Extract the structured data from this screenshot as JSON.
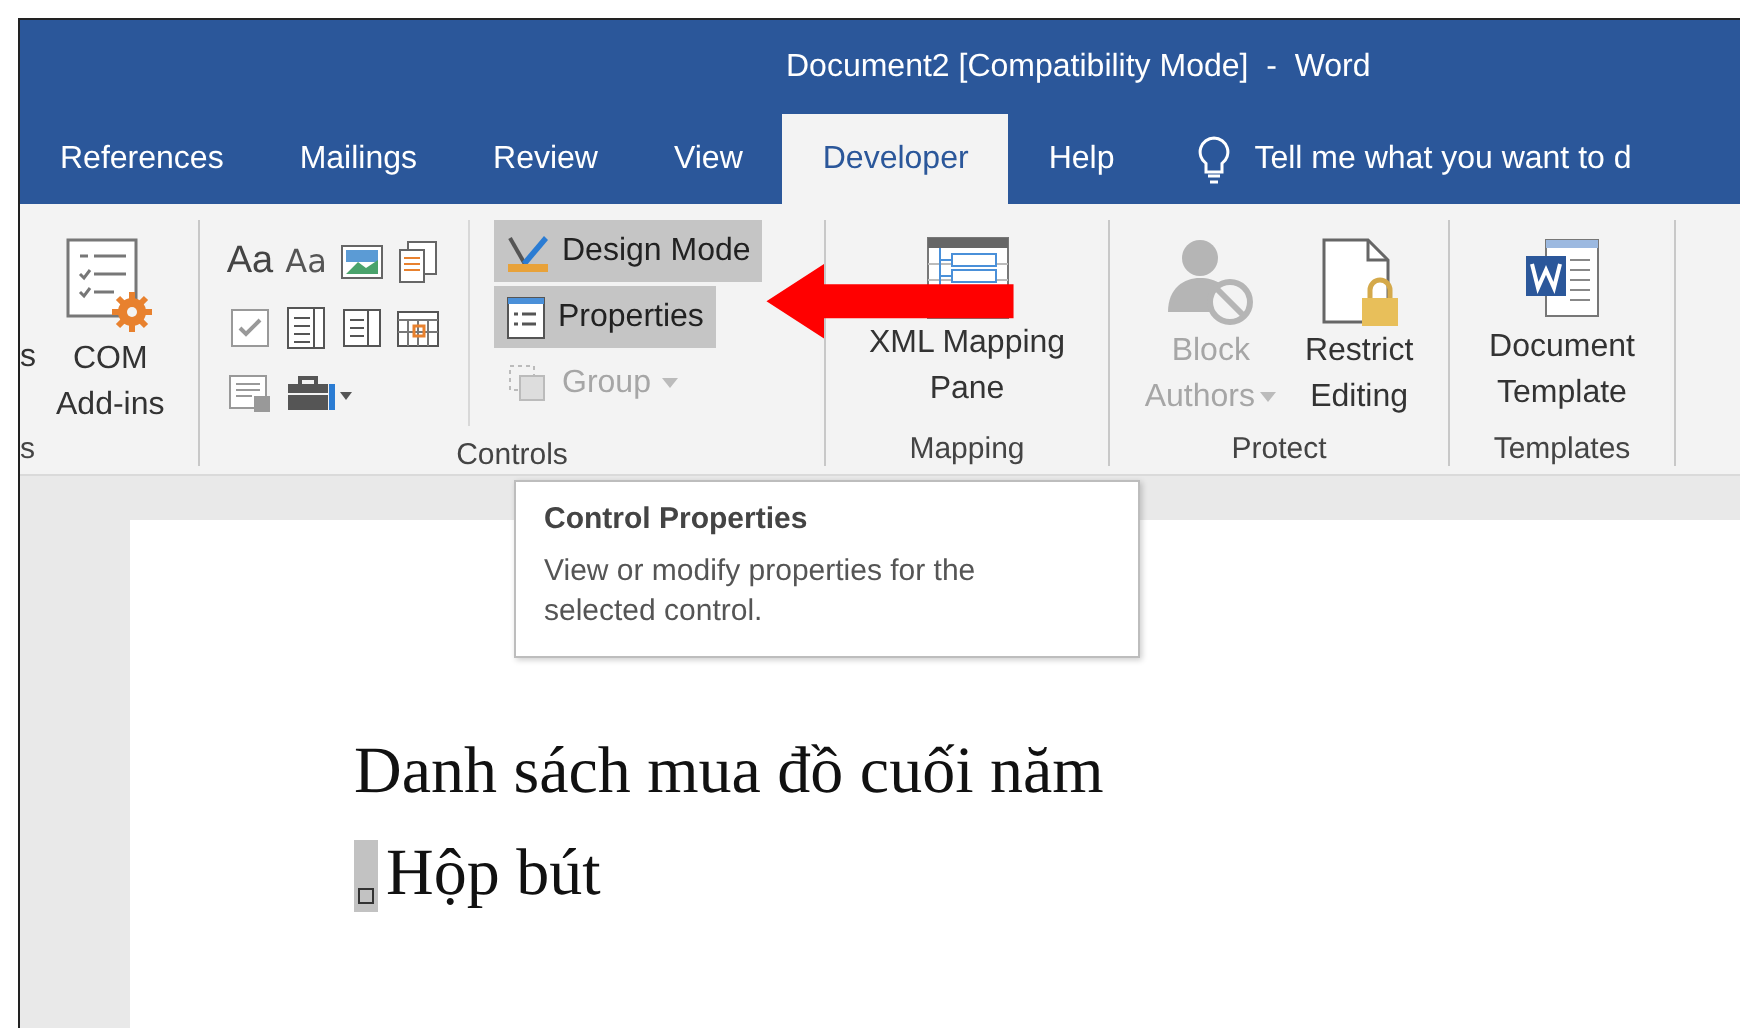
{
  "window": {
    "title": "Document2 [Compatibility Mode]  -  Word"
  },
  "tabs": [
    {
      "label": "References",
      "selected": false
    },
    {
      "label": "Mailings",
      "selected": false
    },
    {
      "label": "Review",
      "selected": false
    },
    {
      "label": "View",
      "selected": false
    },
    {
      "label": "Developer",
      "selected": true
    },
    {
      "label": "Help",
      "selected": false
    }
  ],
  "tell_me": {
    "placeholder": "Tell me what you want to d"
  },
  "ribbon": {
    "groups": [
      {
        "kind": "addins",
        "label": "s",
        "cut_text": "s",
        "buttons": [
          {
            "kind": "com",
            "lines": [
              "COM",
              "Add-ins"
            ],
            "disabled": false
          }
        ]
      },
      {
        "kind": "controls",
        "label": "Controls",
        "gallery": [
          {
            "kind": "glyph",
            "glyph": "Aa"
          },
          {
            "kind": "glyph-light",
            "glyph": "Aa"
          },
          {
            "kind": "picture"
          },
          {
            "kind": "building-block"
          },
          {
            "kind": "checkbox"
          },
          {
            "kind": "combo"
          },
          {
            "kind": "dropdown"
          },
          {
            "kind": "date"
          },
          {
            "kind": "repeating"
          },
          {
            "kind": "tools"
          }
        ],
        "commands": [
          {
            "kind": "design",
            "label": "Design Mode",
            "highlighted": true,
            "disabled": false,
            "dropdown": false
          },
          {
            "kind": "properties",
            "label": "Properties",
            "highlighted": true,
            "disabled": false,
            "dropdown": false
          },
          {
            "kind": "group",
            "label": "Group",
            "highlighted": false,
            "disabled": true,
            "dropdown": true
          }
        ]
      },
      {
        "kind": "large",
        "label": "Mapping",
        "buttons": [
          {
            "kind": "xml",
            "lines": [
              "XML Mapping",
              "Pane"
            ],
            "disabled": false
          }
        ]
      },
      {
        "kind": "large",
        "label": "Protect",
        "buttons": [
          {
            "kind": "block",
            "lines": [
              "Block",
              "Authors"
            ],
            "disabled": true,
            "dropdown": true
          },
          {
            "kind": "restrict",
            "lines": [
              "Restrict",
              "Editing"
            ],
            "disabled": false
          }
        ]
      },
      {
        "kind": "large",
        "label": "Templates",
        "buttons": [
          {
            "kind": "template",
            "lines": [
              "Document",
              "Template"
            ],
            "disabled": false
          }
        ]
      }
    ]
  },
  "tooltip": {
    "title": "Control Properties",
    "description": "View or modify properties for the selected control."
  },
  "document": {
    "paragraphs": [
      {
        "kind": "heading",
        "text": "Danh sách mua đồ cuối năm"
      },
      {
        "kind": "control",
        "text": "Hộp bút"
      }
    ]
  }
}
